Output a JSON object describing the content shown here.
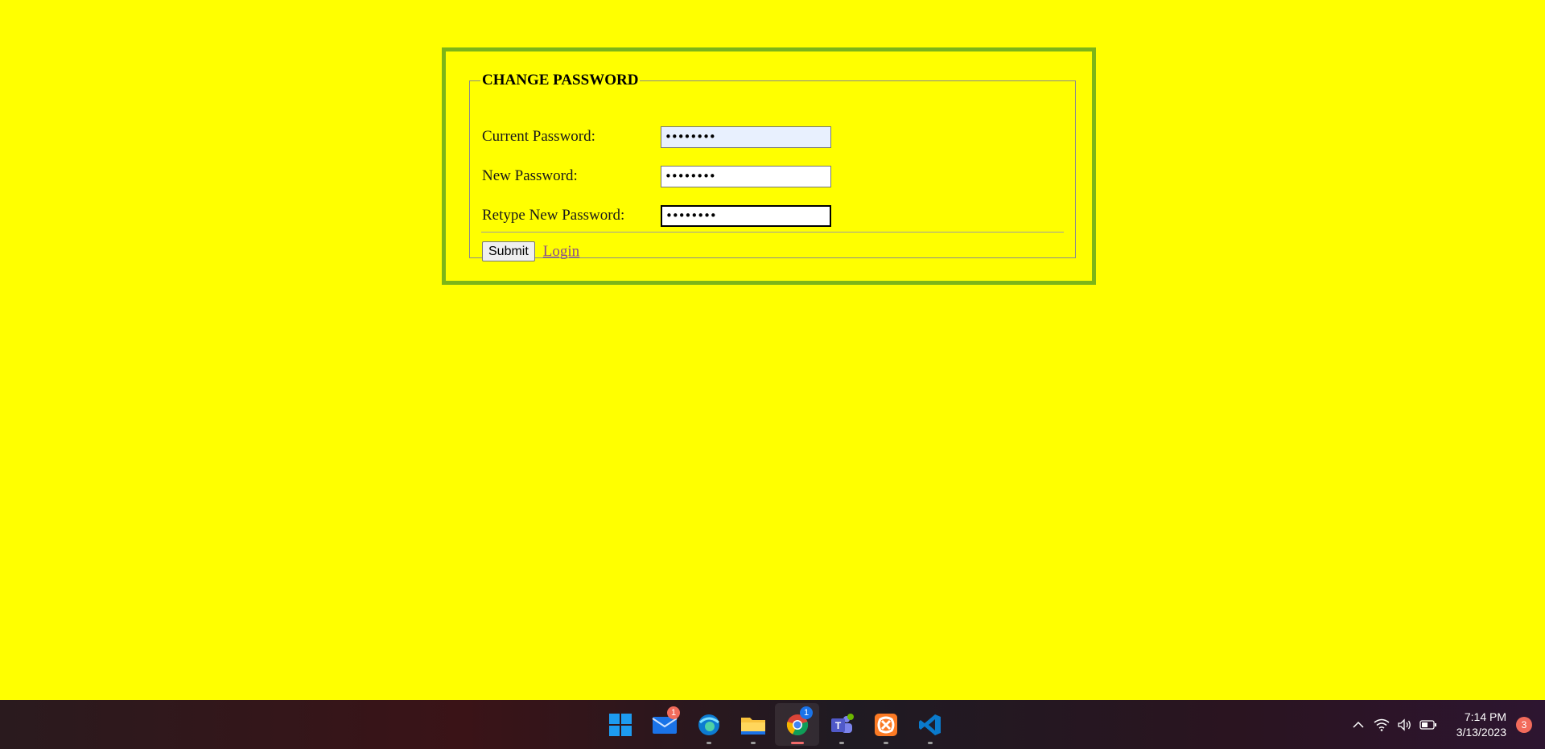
{
  "form": {
    "legend": "CHANGE PASSWORD",
    "fields": [
      {
        "label": "Current Password:",
        "value": "••••••••"
      },
      {
        "label": "New Password:",
        "value": "••••••••"
      },
      {
        "label": "Retype New Password:",
        "value": "••••••••"
      }
    ],
    "submit_label": "Submit",
    "login_link": "Login"
  },
  "colors": {
    "page_background": "#ffff00",
    "frame_border": "#7cb518",
    "link": "#8a4b8a"
  },
  "taskbar": {
    "apps": [
      {
        "name": "start-icon"
      },
      {
        "name": "mail-icon",
        "badge": "1"
      },
      {
        "name": "edge-icon"
      },
      {
        "name": "file-explorer-icon"
      },
      {
        "name": "chrome-icon",
        "badge": "1"
      },
      {
        "name": "teams-icon"
      },
      {
        "name": "xampp-icon"
      },
      {
        "name": "vscode-icon"
      }
    ],
    "clock": {
      "time": "7:14 PM",
      "date": "3/13/2023"
    },
    "notification_count": "3"
  }
}
